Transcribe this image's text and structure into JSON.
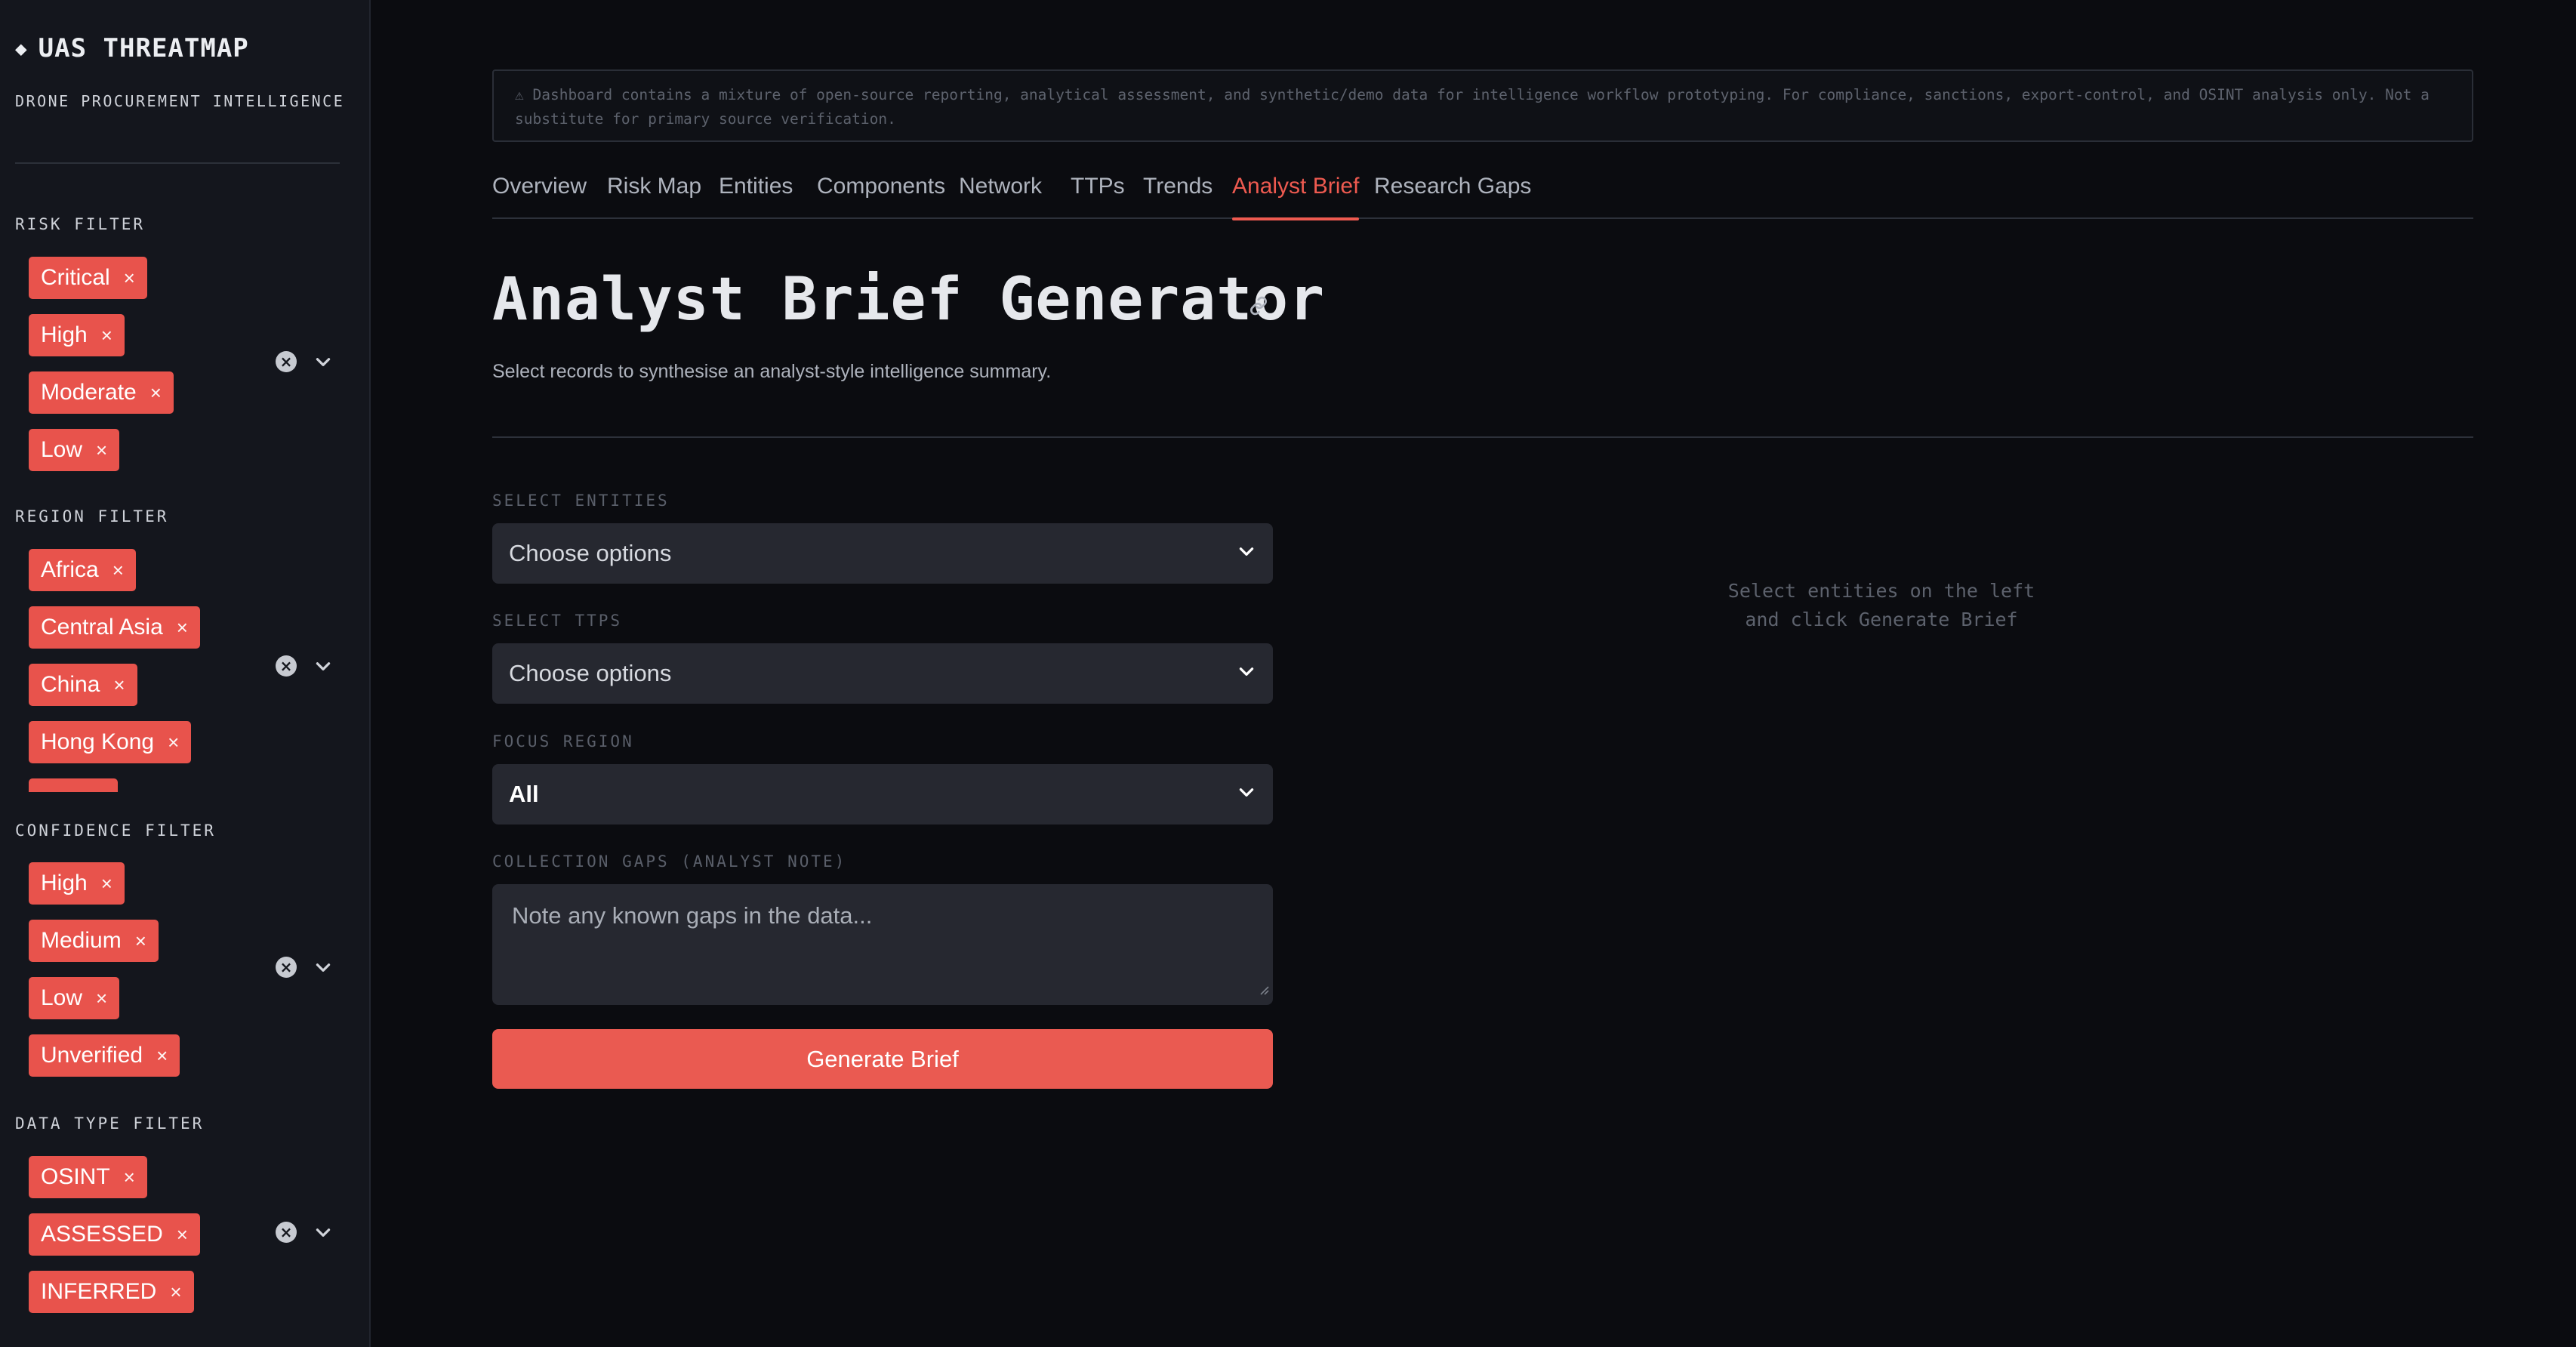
{
  "sidebar": {
    "brand_icon": "diamond-icon",
    "brand": "UAS THREATMAP",
    "subtitle": "DRONE PROCUREMENT INTELLIGENCE",
    "filters": {
      "risk": {
        "label": "RISK FILTER",
        "tags": [
          "Critical",
          "High",
          "Moderate",
          "Low"
        ]
      },
      "region": {
        "label": "REGION FILTER",
        "tags": [
          "Africa",
          "Central Asia",
          "China",
          "Hong Kong"
        ]
      },
      "confidence": {
        "label": "CONFIDENCE FILTER",
        "tags": [
          "High",
          "Medium",
          "Low",
          "Unverified"
        ]
      },
      "datatype": {
        "label": "DATA TYPE FILTER",
        "tags": [
          "OSINT",
          "ASSESSED",
          "INFERRED"
        ]
      }
    },
    "tag_remove_glyph": "×",
    "clear_glyph": "×"
  },
  "notice": {
    "text": "⚠ Dashboard contains a mixture of open-source reporting, analytical assessment, and synthetic/demo data for intelligence workflow prototyping. For compliance, sanctions, export-control, and OSINT analysis only. Not a substitute for primary source verification."
  },
  "tabs": [
    {
      "label": "Overview",
      "active": false
    },
    {
      "label": "Risk Map",
      "active": false
    },
    {
      "label": "Entities",
      "active": false
    },
    {
      "label": "Components",
      "active": false
    },
    {
      "label": "Network",
      "active": false
    },
    {
      "label": "TTPs",
      "active": false
    },
    {
      "label": "Trends",
      "active": false
    },
    {
      "label": "Analyst Brief",
      "active": true
    },
    {
      "label": "Research Gaps",
      "active": false
    }
  ],
  "page": {
    "title": "Analyst Brief Generator",
    "subtitle": "Select records to synthesise an analyst-style intelligence summary."
  },
  "form": {
    "entities": {
      "label": "SELECT ENTITIES",
      "placeholder": "Choose options"
    },
    "ttps": {
      "label": "SELECT TTPS",
      "placeholder": "Choose options"
    },
    "region": {
      "label": "FOCUS REGION",
      "value": "All"
    },
    "gaps": {
      "label": "COLLECTION GAPS (ANALYST NOTE)",
      "placeholder": "Note any known gaps in the data..."
    },
    "generate_label": "Generate Brief"
  },
  "empty_state": {
    "line1": "Select entities on the left",
    "line2": "and click Generate Brief"
  },
  "colors": {
    "accent": "#ea5a51",
    "background": "#0b0c10",
    "sidebar": "#14161d",
    "input": "#262830"
  }
}
